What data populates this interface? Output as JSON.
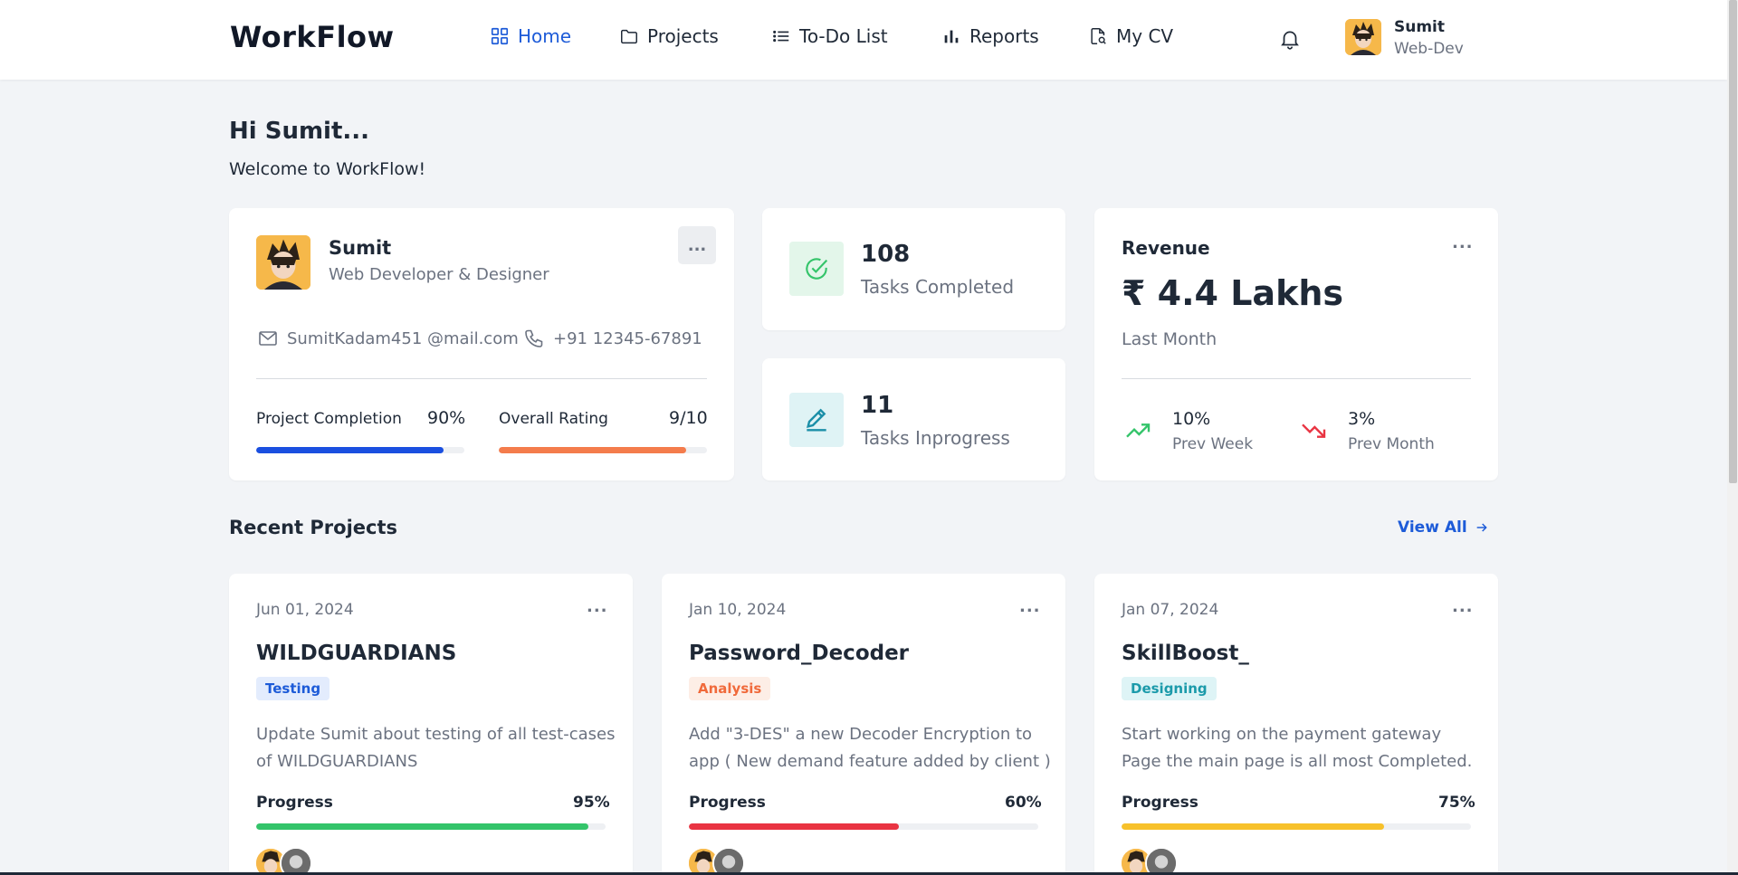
{
  "header": {
    "brand": "WorkFlow",
    "nav": [
      {
        "label": "Home",
        "icon": "grid-icon",
        "active": true
      },
      {
        "label": "Projects",
        "icon": "folder-icon"
      },
      {
        "label": "To-Do List",
        "icon": "list-icon"
      },
      {
        "label": "Reports",
        "icon": "bar-chart-icon"
      },
      {
        "label": "My CV",
        "icon": "document-search-icon"
      }
    ],
    "user": {
      "name": "Sumit",
      "role": "Web-Dev"
    }
  },
  "greeting": {
    "title": "Hi Sumit...",
    "subtitle": "Welcome to WorkFlow!"
  },
  "profile": {
    "name": "Sumit",
    "title": "Web Developer & Designer",
    "email": "SumitKadam451 @mail.com",
    "phone": "+91 12345-67891",
    "project_completion": {
      "label": "Project Completion",
      "value": "90%",
      "fraction": 0.9
    },
    "overall_rating": {
      "label": "Overall Rating",
      "value": "9/10",
      "fraction": 0.9
    },
    "menu_label": "..."
  },
  "stats": {
    "completed": {
      "number": "108",
      "label": "Tasks Completed"
    },
    "inprogress": {
      "number": "11",
      "label": "Tasks Inprogress"
    }
  },
  "revenue": {
    "title": "Revenue",
    "amount": "₹ 4.4 Lakhs",
    "period": "Last Month",
    "menu_label": "...",
    "week": {
      "pct": "10%",
      "label": "Prev Week",
      "direction": "up"
    },
    "month": {
      "pct": "3%",
      "label": "Prev Month",
      "direction": "down"
    }
  },
  "recent": {
    "title": "Recent Projects",
    "view_all": "View All",
    "projects": [
      {
        "date": "Jun 01, 2024",
        "name": "WILDGUARDIANS",
        "tag": "Testing",
        "desc": "Update Sumit about testing of all test-cases of WILDGUARDIANS",
        "progress_label": "Progress",
        "progress": "95%",
        "fraction": 0.95,
        "color": "#34c46a",
        "menu": "..."
      },
      {
        "date": "Jan 10, 2024",
        "name": "Password_Decoder",
        "tag": "Analysis",
        "desc": "Add \"3-DES\" a new Decoder Encryption to app ( New demand feature added by client )",
        "progress_label": "Progress",
        "progress": "60%",
        "fraction": 0.6,
        "color": "#e93442",
        "menu": "..."
      },
      {
        "date": "Jan 07, 2024",
        "name": "SkillBoost_",
        "tag": "Designing",
        "desc": "Start working on the payment gateway Page the main page is all most Completed.",
        "progress_label": "Progress",
        "progress": "75%",
        "fraction": 0.75,
        "color": "#f7c12b",
        "menu": "..."
      }
    ]
  },
  "colors": {
    "accent": "#1d5bd8",
    "completion_bar": "#1a4fe0",
    "rating_bar": "#f47c4c",
    "success": "#34c46a",
    "danger": "#e93442",
    "warning": "#f7c12b"
  }
}
